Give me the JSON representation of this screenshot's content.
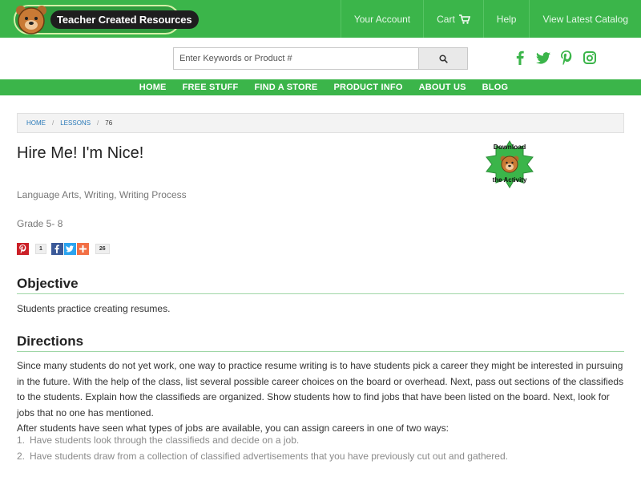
{
  "header": {
    "logo_text": "Teacher Created Resources",
    "nav": [
      {
        "label": "Your Account"
      },
      {
        "label": "Cart"
      },
      {
        "label": "Help"
      },
      {
        "label": "View Latest Catalog"
      }
    ]
  },
  "search": {
    "placeholder": "Enter Keywords or Product #"
  },
  "social": [
    "facebook-icon",
    "twitter-icon",
    "pinterest-icon",
    "instagram-icon"
  ],
  "main_nav": [
    "HOME",
    "FREE STUFF",
    "FIND A STORE",
    "PRODUCT INFO",
    "ABOUT US",
    "BLOG"
  ],
  "breadcrumb": {
    "items": [
      "HOME",
      "LESSONS"
    ],
    "current": "76",
    "separator": "/"
  },
  "lesson": {
    "title": "Hire Me! I'm Nice!",
    "download_line1": "Download",
    "download_line2": "the Activity",
    "subjects": "Language Arts, Writing, Writing Process",
    "grade": "Grade 5- 8",
    "share": {
      "pinterest_count": "1",
      "total_count": "26"
    }
  },
  "objective": {
    "heading": "Objective",
    "text": "Students practice creating resumes."
  },
  "directions": {
    "heading": "Directions",
    "paragraph": "Since many students do not yet work, one way to practice resume writing is to have students pick a career they might be interested in pursuing in the future. With the help of the class, list several possible career choices on the board or overhead. Next, pass out sections of the classifieds to the students. Explain how the classifieds are organized. Show students how to find jobs that have been listed on the board. Next, look for jobs that no one has mentioned.",
    "intro": "After students have seen what types of jobs are available, you can assign careers in one of two ways:",
    "steps": [
      {
        "num": "1.",
        "text": "Have students look through the classifieds and decide on a job."
      },
      {
        "num": "2.",
        "text": "Have students draw from a collection of classified advertisements that you have previously cut out and gathered."
      }
    ]
  },
  "colors": {
    "brand_green": "#3bb54a",
    "link_blue": "#2a7ab9",
    "pinterest": "#cb2027",
    "facebook": "#3b5998",
    "twitter": "#2aa3ef",
    "plus": "#f26f45"
  }
}
